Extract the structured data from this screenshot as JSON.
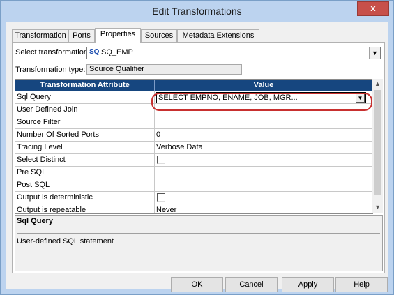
{
  "window": {
    "title": "Edit Transformations",
    "close_label": "x"
  },
  "tabs": [
    {
      "label": "Transformation"
    },
    {
      "label": "Ports"
    },
    {
      "label": "Properties"
    },
    {
      "label": "Sources"
    },
    {
      "label": "Metadata Extensions"
    }
  ],
  "select_transformation": {
    "label": "Select transformation:",
    "icon": "SQ",
    "value": "SQ_EMP"
  },
  "transformation_type": {
    "label": "Transformation type:",
    "value": "Source Qualifier"
  },
  "grid": {
    "headers": [
      "Transformation Attribute",
      "Value"
    ],
    "rows": [
      {
        "attribute": "Sql Query",
        "value": "SELECT  EMPNO,  ENAME,  JOB,  MGR..."
      },
      {
        "attribute": "User Defined Join",
        "value": ""
      },
      {
        "attribute": "Source Filter",
        "value": ""
      },
      {
        "attribute": "Number Of Sorted Ports",
        "value": "0"
      },
      {
        "attribute": "Tracing Level",
        "value": "Verbose Data"
      },
      {
        "attribute": "Select Distinct",
        "value": ""
      },
      {
        "attribute": "Pre SQL",
        "value": ""
      },
      {
        "attribute": "Post SQL",
        "value": ""
      },
      {
        "attribute": "Output is deterministic",
        "value": ""
      },
      {
        "attribute": "Output is repeatable",
        "value": "Never"
      }
    ]
  },
  "description": {
    "title": "Sql Query",
    "text": "User-defined SQL statement"
  },
  "buttons": {
    "ok": "OK",
    "cancel": "Cancel",
    "apply": "Apply",
    "help": "Help"
  },
  "colors": {
    "header_bg": "#16467f",
    "highlight": "#c8302f",
    "title_bg": "#bcd3ef"
  }
}
